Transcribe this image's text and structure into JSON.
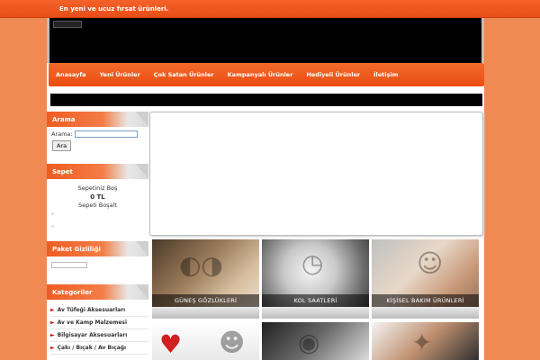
{
  "topbar": {
    "tagline": "En yeni ve ucuz fırsat ürünleri."
  },
  "nav": {
    "items": [
      "Anasayfa",
      "Yeni Ürünler",
      "Çok Satan Ürünler",
      "Kampanyalı Ürünler",
      "Hediyeli Ürünler",
      "İletişim"
    ]
  },
  "search": {
    "title": "Arama",
    "label": "Arama:",
    "value": "",
    "button": "Ara"
  },
  "cart": {
    "title": "Sepet",
    "status": "Sepetiniz Boş",
    "total": "0 TL",
    "clear": "Sepeti Boşalt"
  },
  "package": {
    "title": "Paket Gizliliği"
  },
  "categories": {
    "title": "Kategoriler",
    "items": [
      "Av Tüfeği Aksesuarları",
      "Av ve Kamp Malzemesi",
      "Bilgisayar Aksesuarları",
      "Çakı / Bıçak / Av Bıçağı"
    ]
  },
  "tiles": {
    "sunglasses": "GÜNEŞ GÖZLÜKLERİ",
    "watches": "KOL SAATLERİ",
    "personal_care": "KİŞİSEL BAKIM ÜRÜNLERİ"
  },
  "colors": {
    "accent": "#f05a1f",
    "background": "#f08a52"
  }
}
